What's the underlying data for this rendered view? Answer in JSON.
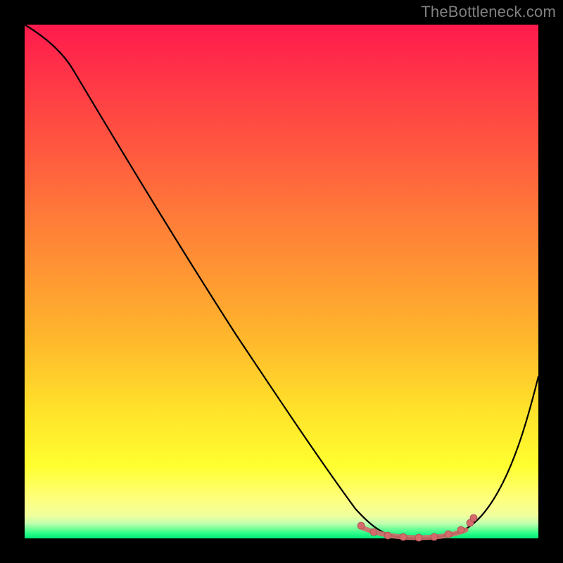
{
  "watermark": "TheBottleneck.com",
  "chart_data": {
    "type": "line",
    "title": "",
    "xlabel": "",
    "ylabel": "",
    "xlim": [
      0,
      100
    ],
    "ylim": [
      0,
      100
    ],
    "x": [
      0,
      3,
      6,
      10,
      15,
      20,
      25,
      30,
      35,
      40,
      45,
      50,
      55,
      60,
      63,
      66,
      69,
      72,
      75,
      78,
      81,
      84,
      87,
      90,
      93,
      96,
      100
    ],
    "values": [
      100,
      98,
      95,
      91,
      85,
      78,
      71,
      65,
      58,
      51,
      44,
      37,
      30,
      22,
      17,
      12,
      7,
      3,
      1,
      0,
      0,
      0,
      2,
      6,
      13,
      22,
      36
    ],
    "highlight_band": {
      "x_start": 66,
      "x_end": 87
    },
    "note": "Values are approximate readings of the black curve inside the gradient square; no axis tick labels are shown in the original image.",
    "gradient_stops": [
      {
        "pos": 0.0,
        "color": "#ff1a4d"
      },
      {
        "pos": 0.5,
        "color": "#ff9a32"
      },
      {
        "pos": 0.86,
        "color": "#ffff30"
      },
      {
        "pos": 0.97,
        "color": "#c6ffb0"
      },
      {
        "pos": 1.0,
        "color": "#00e878"
      }
    ]
  }
}
